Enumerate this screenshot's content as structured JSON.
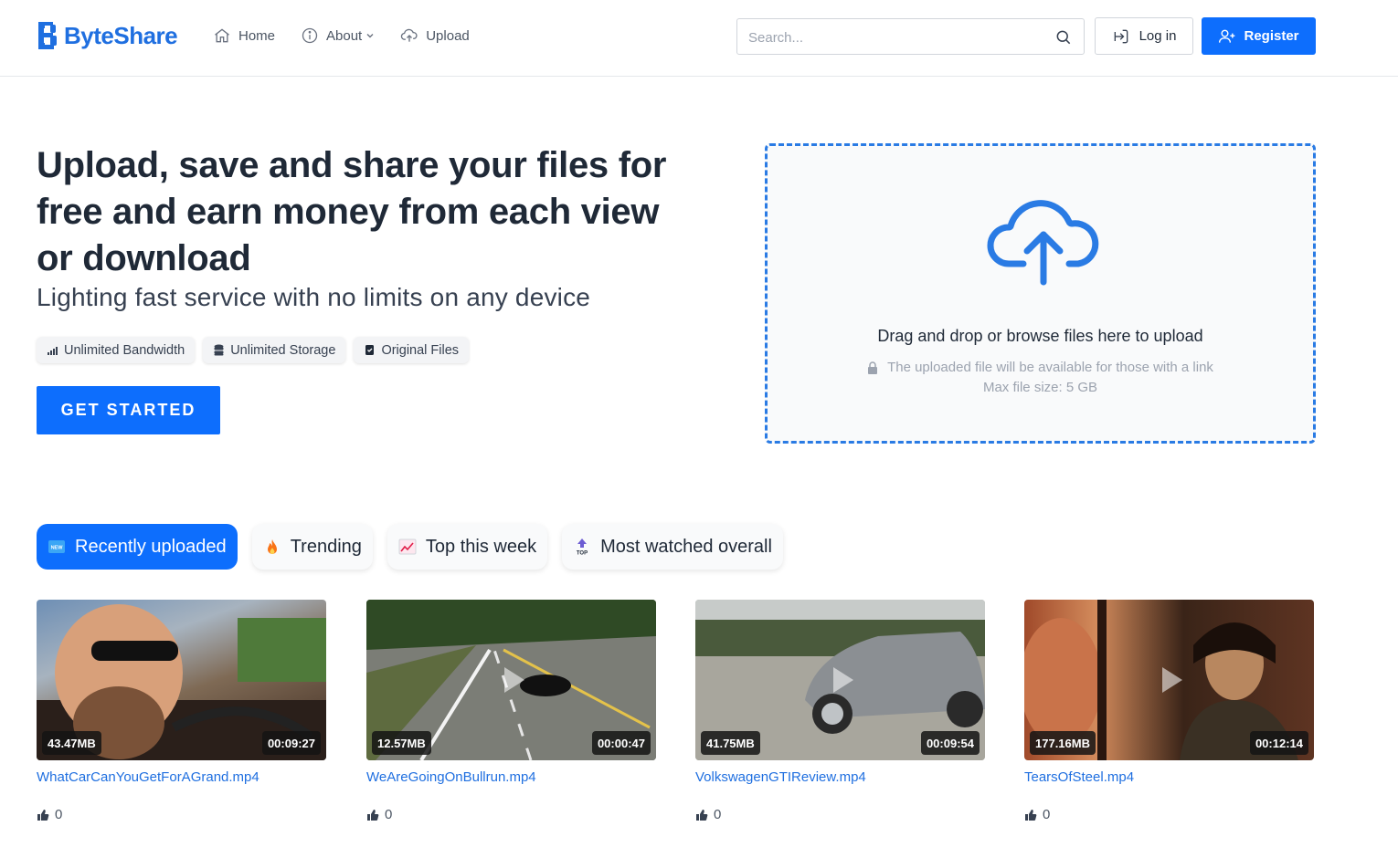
{
  "brand": {
    "name": "ByteShare",
    "color": "#1f6fe0"
  },
  "nav": [
    {
      "label": "Home",
      "icon": "home-icon"
    },
    {
      "label": "About",
      "icon": "info-icon"
    },
    {
      "label": "Upload",
      "icon": "cloud-upload-icon"
    }
  ],
  "search": {
    "placeholder": "Search..."
  },
  "auth": {
    "login": "Log in",
    "register": "Register"
  },
  "hero": {
    "title": "Upload, save and share your files for free and earn money from each view or download",
    "subtitle": "Lighting fast service with no limits on any device",
    "features": [
      "Unlimited Bandwidth",
      "Unlimited Storage",
      "Original Files"
    ],
    "cta": "GET STARTED"
  },
  "dropzone": {
    "text": "Drag and drop or browse files here to upload",
    "note": "The uploaded file will be available for those with a link",
    "max": "Max file size: 5 GB"
  },
  "tabs": [
    {
      "label": "Recently uploaded",
      "icon": "new-icon",
      "active": true
    },
    {
      "label": "Trending",
      "icon": "fire-icon",
      "active": false
    },
    {
      "label": "Top this week",
      "icon": "chart-up-icon",
      "active": false
    },
    {
      "label": "Most watched overall",
      "icon": "top-icon",
      "active": false
    }
  ],
  "videos": [
    {
      "title": "WhatCarCanYouGetForAGrand.mp4",
      "size": "43.47MB",
      "duration": "00:09:27",
      "likes": "0"
    },
    {
      "title": "WeAreGoingOnBullrun.mp4",
      "size": "12.57MB",
      "duration": "00:00:47",
      "likes": "0"
    },
    {
      "title": "VolkswagenGTIReview.mp4",
      "size": "41.75MB",
      "duration": "00:09:54",
      "likes": "0"
    },
    {
      "title": "TearsOfSteel.mp4",
      "size": "177.16MB",
      "duration": "00:12:14",
      "likes": "0"
    }
  ],
  "colors": {
    "primary": "#0d6efd",
    "dropzone_border": "#2a7be4"
  }
}
